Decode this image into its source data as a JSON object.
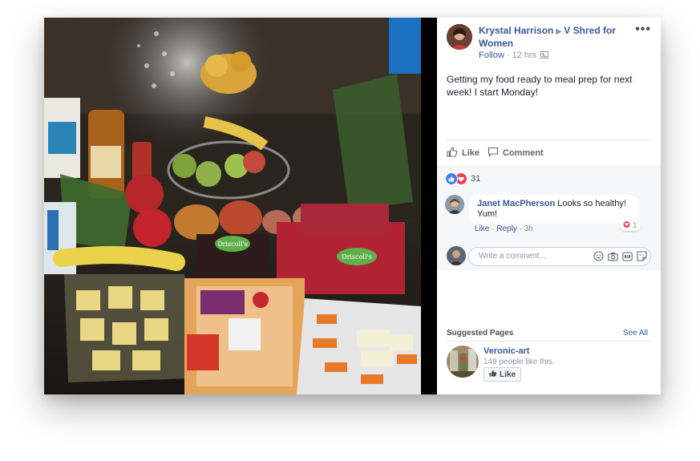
{
  "post": {
    "author": "Krystal Harrison",
    "group": "V Shred for Women",
    "follow": "Follow",
    "time": "12 hrs",
    "text": "Getting my food ready to meal prep for next week! I start Monday!",
    "more": "•••"
  },
  "actions": {
    "like": "Like",
    "comment": "Comment"
  },
  "reactions": {
    "count": "31"
  },
  "comments": [
    {
      "name": "Janet MacPherson",
      "text": "Looks so healthy! Yum!",
      "like": "Like",
      "reply": "Reply",
      "time": "3h",
      "reactions": "1"
    }
  ],
  "composer": {
    "placeholder": "Write a comment..."
  },
  "suggested": {
    "title": "Suggested Pages",
    "see_all": "See All",
    "pages": [
      {
        "name": "Veronic-art",
        "likes": "149 people like this.",
        "button": "Like"
      }
    ]
  },
  "photo_labels": {
    "clamshell_a": "Driscoll's",
    "clamshell_b": "Driscoll's"
  },
  "colors": {
    "link": "#365899",
    "heart": "#f33e58",
    "like_blue": "#4080ff"
  }
}
